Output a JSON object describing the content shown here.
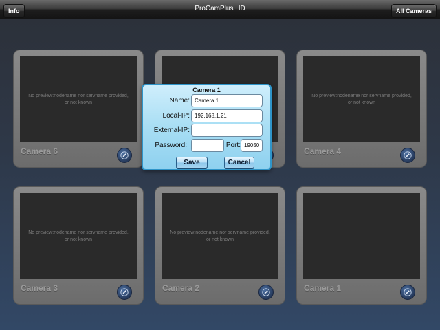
{
  "topbar": {
    "title": "ProCamPlus HD",
    "info_label": "Info",
    "all_cameras_label": "All Cameras"
  },
  "tiles": [
    {
      "label": "Camera 6",
      "preview": "No preview:nodename nor servname provided, or not known"
    },
    {
      "label": "",
      "preview": ""
    },
    {
      "label": "Camera 4",
      "preview": "No preview:nodename nor servname provided, or not known"
    },
    {
      "label": "Camera 3",
      "preview": "No preview:nodename nor servname provided, or not known"
    },
    {
      "label": "Camera 2",
      "preview": "No preview:nodename nor servname provided, or not known"
    },
    {
      "label": "Camera 1",
      "preview": ""
    }
  ],
  "dialog": {
    "title": "Camera 1",
    "name_label": "Name:",
    "name_value": "Camera 1",
    "local_ip_label": "Local-IP:",
    "local_ip_value": "192.168.1.21",
    "external_ip_label": "External-IP:",
    "external_ip_value": "",
    "password_label": "Password:",
    "password_value": "",
    "port_label": "Port:",
    "port_value": "19050",
    "save_label": "Save",
    "cancel_label": "Cancel"
  },
  "icons": {
    "edit_button": "pencil-icon"
  },
  "colors": {
    "dialog_border": "#2f95c9",
    "edit_button": "#263a5c"
  }
}
